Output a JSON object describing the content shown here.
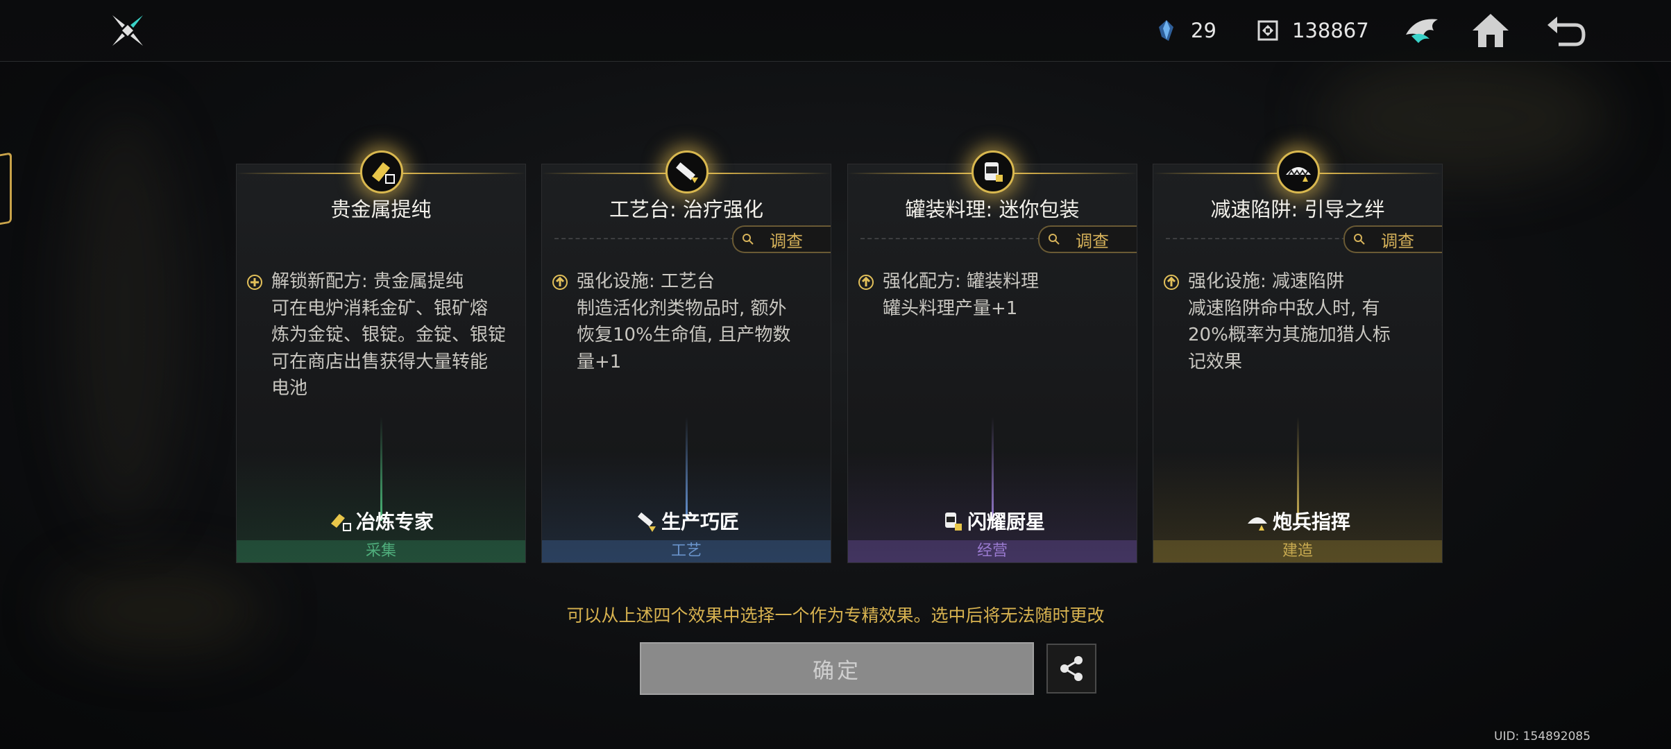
{
  "topbar": {
    "crystal_count": "29",
    "currency_count": "138867",
    "icons": [
      "app-logo-icon",
      "crystal-icon",
      "currency-icon",
      "wolf-emblem-icon",
      "home-icon",
      "back-icon"
    ]
  },
  "cards": [
    {
      "title": "贵金属提纯",
      "has_inspect": false,
      "desc_lines": [
        "解锁新配方: 贵金属提纯",
        "可在电炉消耗金矿、银矿熔",
        "炼为金锭、银锭。金锭、银锭",
        "可在商店出售获得大量转能",
        "电池"
      ],
      "role": "冶炼专家",
      "category": "采集",
      "accent": "#3aa06a"
    },
    {
      "title": "工艺台: 治疗强化",
      "has_inspect": true,
      "desc_lines": [
        "强化设施: 工艺台",
        "制造活化剂类物品时, 额外",
        "恢复10%生命值, 且产物数",
        "量+1"
      ],
      "role": "生产巧匠",
      "category": "工艺",
      "accent": "#4a78b8"
    },
    {
      "title": "罐装料理: 迷你包装",
      "has_inspect": true,
      "desc_lines": [
        "强化配方: 罐装料理",
        "罐头料理产量+1"
      ],
      "role": "闪耀厨星",
      "category": "经营",
      "accent": "#7a5ab8"
    },
    {
      "title": "减速陷阱: 引导之绊",
      "has_inspect": true,
      "desc_lines": [
        "强化设施: 减速陷阱",
        "减速陷阱命中敌人时, 有",
        "20%概率为其施加猎人标",
        "记效果"
      ],
      "role": "炮兵指挥",
      "category": "建造",
      "accent": "#b89a3a"
    }
  ],
  "inspect_label": "调查",
  "hint": "可以从上述四个效果中选择一个作为专精效果。选中后将无法随时更改",
  "confirm_label": "确定",
  "uid": "UID: 154892085"
}
